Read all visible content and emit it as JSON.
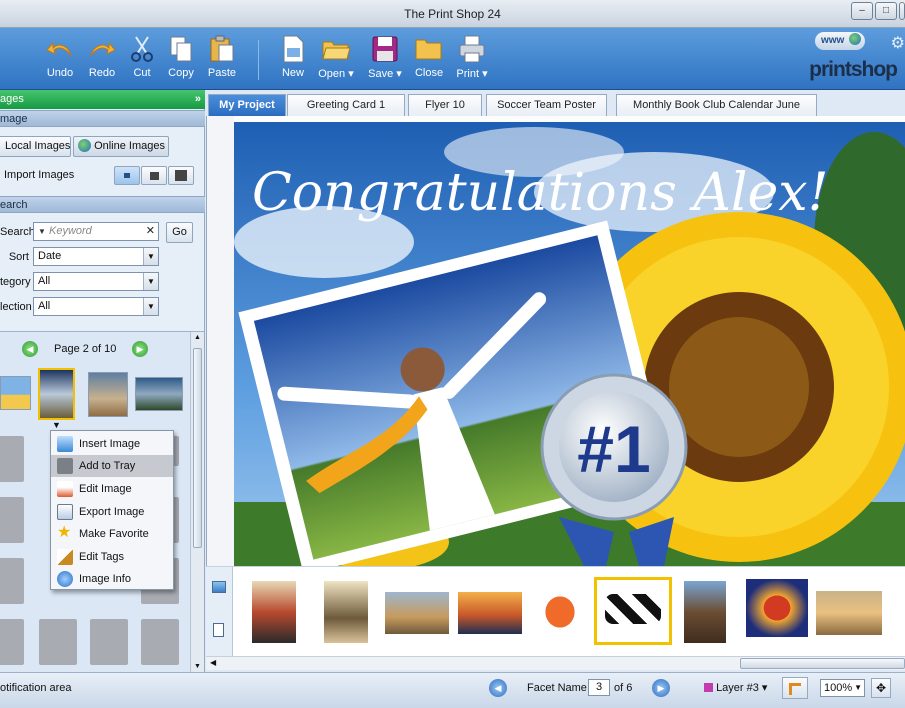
{
  "window": {
    "title": "The Print Shop 24"
  },
  "toolbar": {
    "undo": "Undo",
    "redo": "Redo",
    "cut": "Cut",
    "copy": "Copy",
    "paste": "Paste",
    "new": "New",
    "open": "Open",
    "save": "Save",
    "close": "Close",
    "print": "Print",
    "www": "www",
    "logo": "printshop"
  },
  "left_panel": {
    "header": "ages",
    "image_section": "mage",
    "local_images": "Local Images",
    "online_images": "Online Images",
    "import_images": "Import Images",
    "search_section": "earch",
    "search_label": "Search",
    "keyword_placeholder": "Keyword",
    "go": "Go",
    "sort_label": "Sort",
    "sort_value": "Date",
    "category_label": "tegory",
    "category_value": "All",
    "collection_label": "lection",
    "collection_value": "All",
    "page_info": "Page 2 of 10"
  },
  "context_menu": {
    "items": [
      "Insert Image",
      "Add to Tray",
      "Edit Image",
      "Export Image",
      "Make Favorite",
      "Edit Tags",
      "Image Info"
    ]
  },
  "tabs": [
    "My Project",
    "Greeting Card 1",
    "Flyer 10",
    "Soccer Team Poster",
    "Monthly Book Club Calendar June"
  ],
  "canvas": {
    "headline": "Congratulations Alex!",
    "badge": "#1"
  },
  "status": {
    "notification": "otification area",
    "facet_label": "Facet Name",
    "facet_value": "3",
    "facet_total": "of 6",
    "layer": "Layer #3",
    "zoom": "100%"
  },
  "colors": {
    "accent": "#2f73c2",
    "active_tab": "#3a7fd0",
    "selection": "#f2c200"
  }
}
